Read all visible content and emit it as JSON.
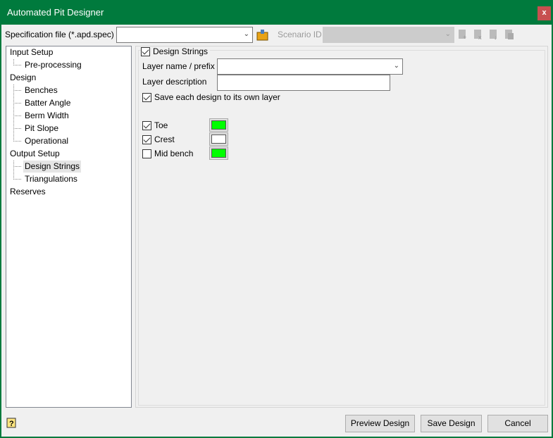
{
  "window": {
    "title": "Automated Pit Designer",
    "close_label": "x"
  },
  "toolbar": {
    "spec_label": "Specification file (*.apd.spec)",
    "spec_value": "",
    "scenario_label": "Scenario ID",
    "scenario_value": ""
  },
  "tree": {
    "items": [
      {
        "label": "Input Setup",
        "level": 0
      },
      {
        "label": "Pre-processing",
        "level": 1
      },
      {
        "label": "Design",
        "level": 0
      },
      {
        "label": "Benches",
        "level": 1
      },
      {
        "label": "Batter Angle",
        "level": 1
      },
      {
        "label": "Berm Width",
        "level": 1
      },
      {
        "label": "Pit Slope",
        "level": 1
      },
      {
        "label": "Operational",
        "level": 1
      },
      {
        "label": "Output Setup",
        "level": 0
      },
      {
        "label": "Design Strings",
        "level": 1,
        "selected": true
      },
      {
        "label": "Triangulations",
        "level": 1
      },
      {
        "label": "Reserves",
        "level": 0
      }
    ]
  },
  "design_strings": {
    "group_label": "Design Strings",
    "group_checked": true,
    "layer_name_label": "Layer name / prefix",
    "layer_name_value": "",
    "layer_desc_label": "Layer description",
    "layer_desc_value": "",
    "save_each_label": "Save each design to its own layer",
    "save_each_checked": true,
    "items": [
      {
        "label": "Toe",
        "checked": true,
        "color": "#00ff00"
      },
      {
        "label": "Crest",
        "checked": true,
        "color": "#ffffff"
      },
      {
        "label": "Mid bench",
        "checked": false,
        "color": "#00ff00"
      }
    ]
  },
  "footer": {
    "preview_label": "Preview Design",
    "save_label": "Save Design",
    "cancel_label": "Cancel"
  }
}
